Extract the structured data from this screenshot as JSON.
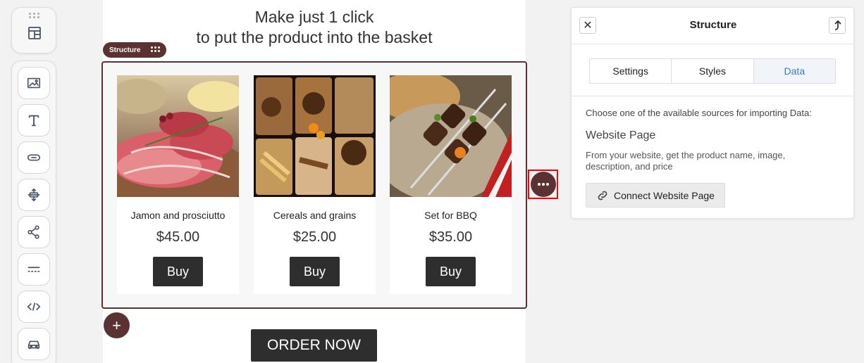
{
  "headline": {
    "line1": "Make just 1 click",
    "line2": "to put the product into the basket"
  },
  "structure_chip": {
    "label": "Structure"
  },
  "products": [
    {
      "name": "Jamon and prosciutto",
      "price": "$45.00",
      "buy_label": "Buy"
    },
    {
      "name": "Cereals and grains",
      "price": "$25.00",
      "buy_label": "Buy"
    },
    {
      "name": "Set for BBQ",
      "price": "$35.00",
      "buy_label": "Buy"
    }
  ],
  "add_button": {
    "label": "+"
  },
  "order_button": {
    "label": "ORDER NOW"
  },
  "panel": {
    "title": "Structure",
    "close_label": "✕",
    "tabs": [
      {
        "label": "Settings",
        "active": false
      },
      {
        "label": "Styles",
        "active": false
      },
      {
        "label": "Data",
        "active": true
      }
    ],
    "intro": "Choose one of the available sources for importing Data:",
    "source_title": "Website Page",
    "source_description": "From your website, get the product name, image, description, and price",
    "connect_label": "Connect Website Page"
  },
  "colors": {
    "accent": "#5b3232",
    "button_dark": "#2e2e2e",
    "highlight": "#ff0000",
    "active_tab_text": "#3b7ad1"
  },
  "icons": {
    "toolbar": [
      "drag-handle-icon",
      "layout-block-icon",
      "image-icon",
      "text-icon",
      "button-icon",
      "spacer-icon",
      "share-icon",
      "divider-icon",
      "code-icon",
      "car-icon"
    ],
    "panel": [
      "close-icon",
      "move-up-icon",
      "link-icon"
    ],
    "canvas": [
      "more-options-icon",
      "plus-icon"
    ]
  }
}
